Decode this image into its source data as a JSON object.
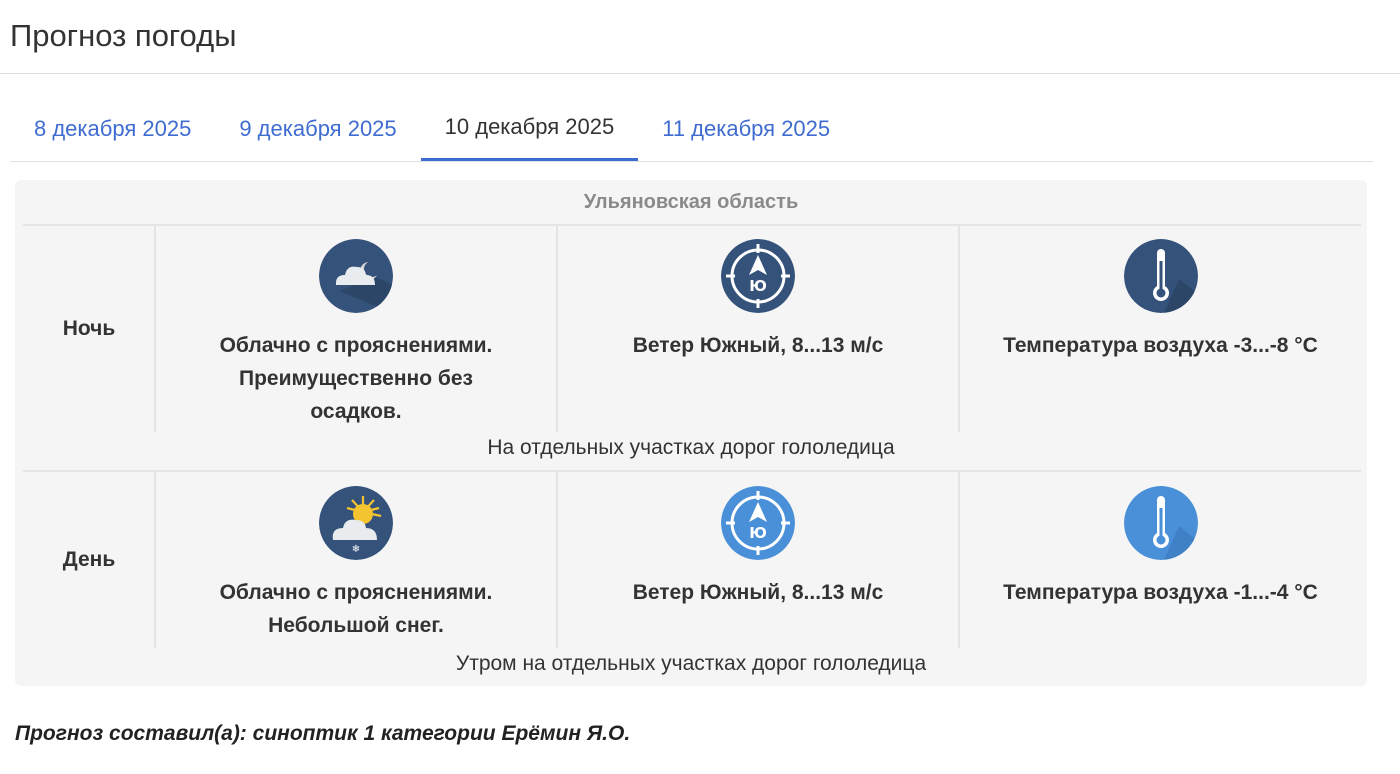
{
  "page": {
    "title": "Прогноз погоды"
  },
  "tabs": [
    {
      "label": "8 декабря 2025",
      "active": false
    },
    {
      "label": "9 декабря 2025",
      "active": false
    },
    {
      "label": "10 декабря 2025",
      "active": true
    },
    {
      "label": "11 декабря 2025",
      "active": false
    }
  ],
  "forecast": {
    "region": "Ульяновская область",
    "rows": [
      {
        "period": "Ночь",
        "sky": "Облачно с прояснениями. Преимущественно без осадков.",
        "wind": "Ветер Южный, 8...13 м/с",
        "temp": "Температура воздуха -3...-8 °C",
        "note": "На отдельных участках дорог гололедица",
        "wind_dir_label": "Ю",
        "icon_color": "#34527a"
      },
      {
        "period": "День",
        "sky": "Облачно с прояснениями. Небольшой снег.",
        "wind": "Ветер Южный, 8...13 м/с",
        "temp": "Температура воздуха -1...-4 °C",
        "note": "Утром на отдельных участках дорог гололедица",
        "wind_dir_label": "Ю",
        "icon_color": "#4a90d8"
      }
    ]
  },
  "footer": {
    "text": "Прогноз составил(а): синоптик 1 категории Ерёмин Я.О."
  },
  "colors": {
    "link": "#3f6cd0",
    "night_icon": "#34527a",
    "day_icon": "#4a90d8",
    "sun": "#f4c430"
  },
  "icons": [
    "night-cloud-icon",
    "wind-compass-icon",
    "thermometer-icon",
    "day-sun-cloud-snow-icon"
  ]
}
